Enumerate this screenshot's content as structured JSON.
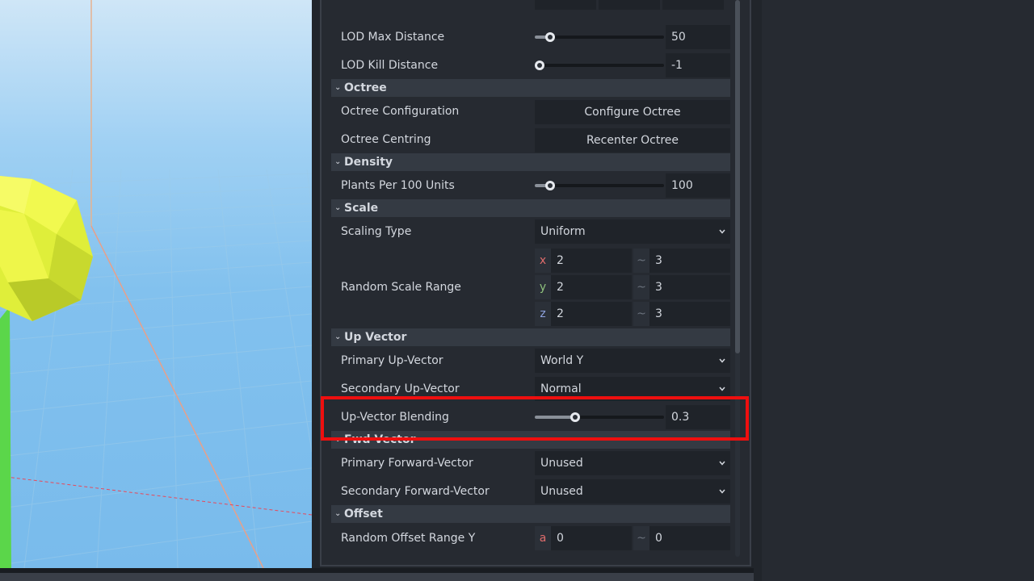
{
  "inspector": {
    "lod": {
      "max_distance_label": "LOD Max Distance",
      "max_distance_value": "50",
      "max_distance_level": 0.09,
      "kill_distance_label": "LOD Kill Distance",
      "kill_distance_value": "-1",
      "kill_distance_level": 0.0
    },
    "octree": {
      "section_title": "Octree",
      "configuration_label": "Octree Configuration",
      "configure_button": "Configure Octree",
      "centring_label": "Octree Centring",
      "recenter_button": "Recenter Octree"
    },
    "density": {
      "section_title": "Density",
      "plants_label": "Plants Per 100 Units",
      "plants_value": "100",
      "plants_level": 0.09
    },
    "scale": {
      "section_title": "Scale",
      "scaling_type_label": "Scaling Type",
      "scaling_type_value": "Uniform",
      "random_range_label": "Random Scale Range",
      "range": [
        {
          "axis": "x",
          "min": "2",
          "sep": "~",
          "max": "3"
        },
        {
          "axis": "y",
          "min": "2",
          "sep": "~",
          "max": "3"
        },
        {
          "axis": "z",
          "min": "2",
          "sep": "~",
          "max": "3"
        }
      ]
    },
    "up_vector": {
      "section_title": "Up Vector",
      "primary_label": "Primary Up-Vector",
      "primary_value": "World Y",
      "secondary_label": "Secondary Up-Vector",
      "secondary_value": "Normal",
      "blending_label": "Up-Vector Blending",
      "blending_value": "0.3",
      "blending_level": 0.3
    },
    "fwd_vector": {
      "section_title": "Fwd Vector",
      "primary_label": "Primary Forward-Vector",
      "primary_value": "Unused",
      "secondary_label": "Secondary Forward-Vector",
      "secondary_value": "Unused"
    },
    "offset": {
      "section_title": "Offset",
      "random_y_label": "Random Offset Range Y",
      "axis": "a",
      "min": "0",
      "sep": "~",
      "max": "0"
    }
  },
  "colors": {
    "highlight": "#ee0f0f",
    "axis_x": "#e06c6c",
    "axis_y": "#8ec07c",
    "axis_z": "#8fa3e0",
    "sky": "#82c1ee",
    "foliage": "#e9f53c"
  }
}
